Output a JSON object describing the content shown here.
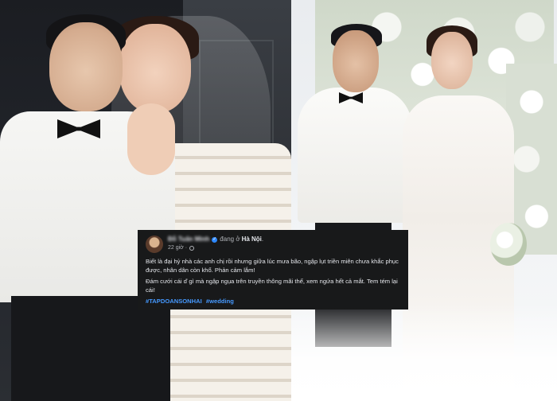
{
  "post": {
    "author": "Đỗ Tuấn Minh",
    "status_text": "đang ở",
    "location": "Hà Nội",
    "time": "22 giờ",
    "paragraph_1": "Biết là đại hỷ nhà các anh chị rồi nhưng giữa lúc mưa bão, ngập lụt triền miên chưa khắc phục được, nhân dân còn khổ. Phản cảm lắm!",
    "paragraph_2": "Đám cưới cái ď gì mà ngập ngụa trên truyền thông mãi thế, xem ngứa hết cả mắt. Tem tém lại cái!",
    "hashtags": [
      "#TAPDOANSONHAI",
      "#wedding"
    ]
  },
  "colors": {
    "post_background": "#18191a",
    "post_text": "#e4e6eb",
    "secondary_text": "#b0b3b8",
    "hashtag": "#4599ff",
    "verified_badge": "#2d88ff"
  },
  "icons": {
    "verified": "verified-badge-icon",
    "privacy": "globe-icon"
  }
}
